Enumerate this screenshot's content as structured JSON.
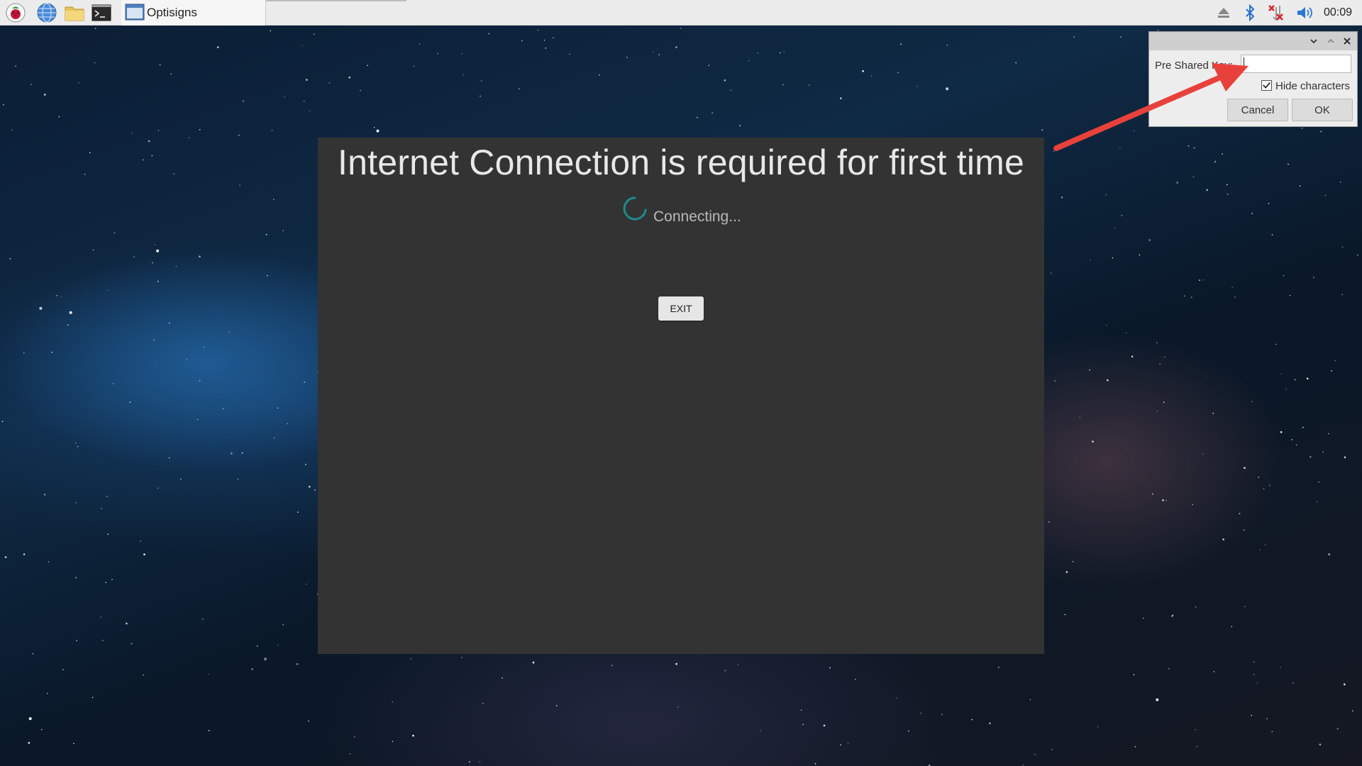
{
  "taskbar": {
    "launchers": [
      {
        "icon": "raspberry-menu-icon"
      },
      {
        "icon": "web-browser-icon"
      },
      {
        "icon": "file-manager-icon"
      },
      {
        "icon": "terminal-icon"
      }
    ],
    "task_button": {
      "label": "Optisigns",
      "icon": "window-icon"
    },
    "tray": [
      {
        "icon": "eject-icon"
      },
      {
        "icon": "bluetooth-icon"
      },
      {
        "icon": "network-disconnected-icon"
      },
      {
        "icon": "volume-icon"
      }
    ],
    "clock": "00:09"
  },
  "app": {
    "title": "Internet Connection is required for first time",
    "status": "Connecting...",
    "exit_label": "EXIT",
    "spinner_color": "#1f8a8a"
  },
  "psk_dialog": {
    "key_label": "Pre Shared Key:",
    "key_value": "",
    "hide_label": "Hide characters",
    "hide_checked": true,
    "cancel_label": "Cancel",
    "ok_label": "OK"
  },
  "annotation": {
    "arrow_color": "#e8413b"
  }
}
